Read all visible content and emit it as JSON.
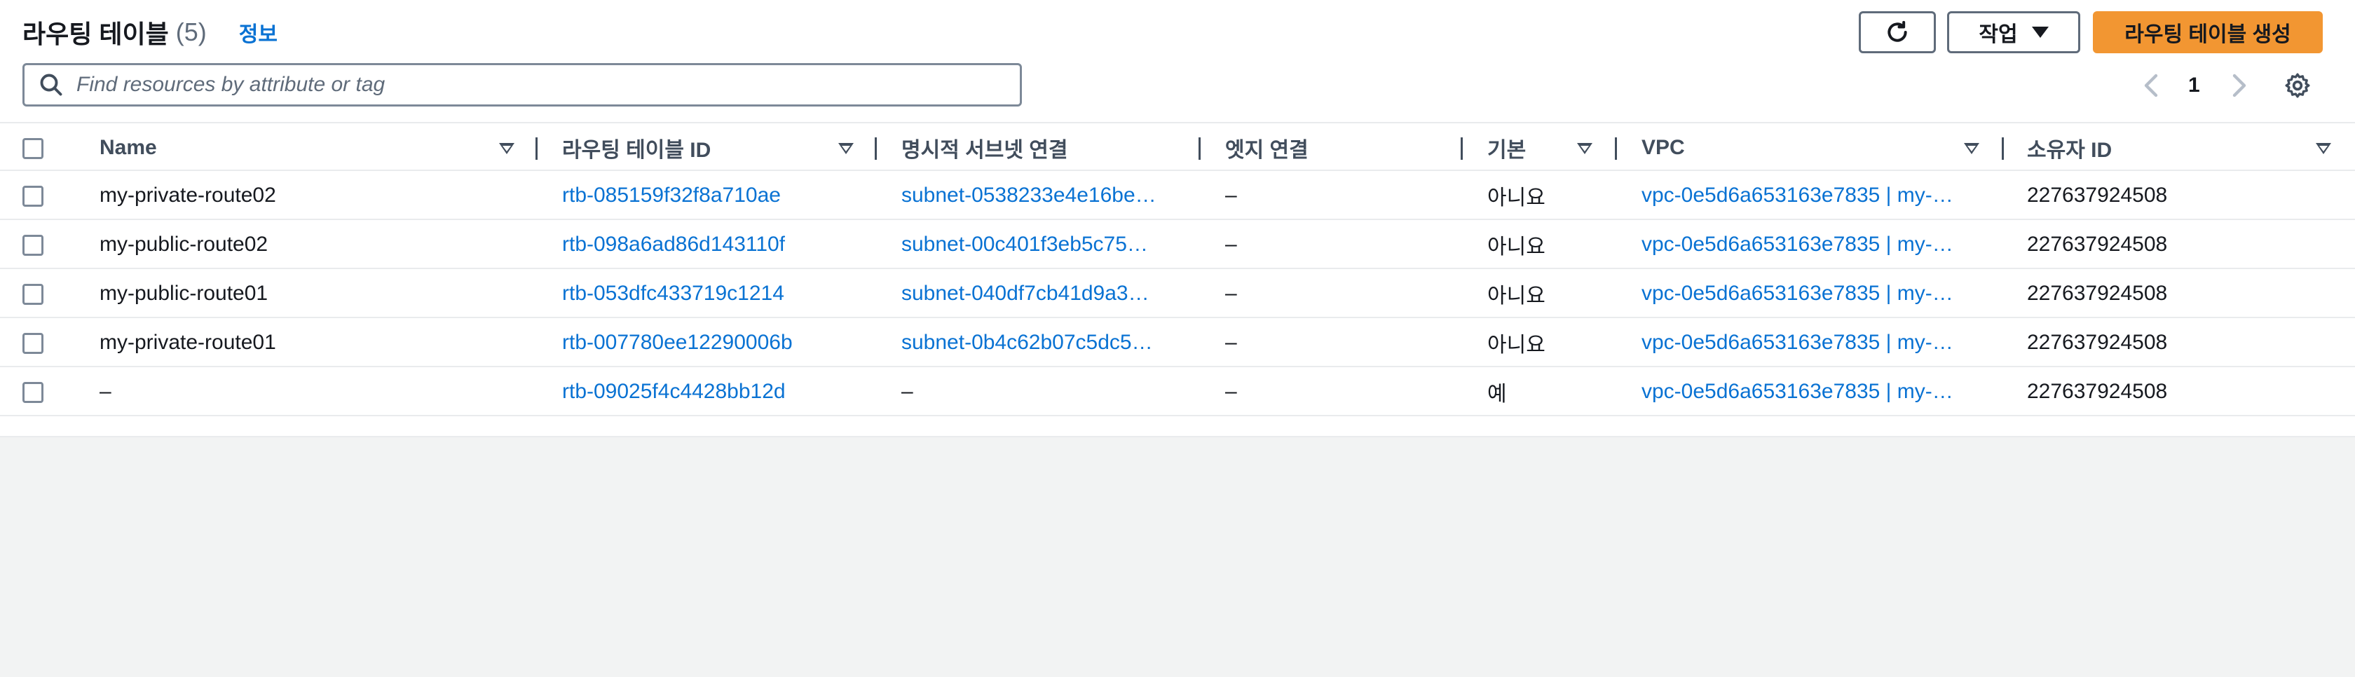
{
  "header": {
    "title": "라우팅 테이블",
    "count": "(5)",
    "info_link": "정보"
  },
  "toolbar": {
    "refresh_icon": "refresh-icon",
    "actions_label": "작업",
    "create_label": "라우팅 테이블 생성"
  },
  "search": {
    "placeholder": "Find resources by attribute or tag"
  },
  "pagination": {
    "current_page": "1"
  },
  "table": {
    "columns": {
      "name": "Name",
      "route_table_id": "라우팅 테이블 ID",
      "explicit_subnet": "명시적 서브넷 연결",
      "edge": "엣지 연결",
      "main": "기본",
      "vpc": "VPC",
      "owner": "소유자 ID"
    },
    "rows": [
      {
        "name": "my-private-route02",
        "rtb": "rtb-085159f32f8a710ae",
        "subnet": "subnet-0538233e4e16be…",
        "edge": "–",
        "main": "아니요",
        "vpc": "vpc-0e5d6a653163e7835 | my-…",
        "owner": "227637924508"
      },
      {
        "name": "my-public-route02",
        "rtb": "rtb-098a6ad86d143110f",
        "subnet": "subnet-00c401f3eb5c75…",
        "edge": "–",
        "main": "아니요",
        "vpc": "vpc-0e5d6a653163e7835 | my-…",
        "owner": "227637924508"
      },
      {
        "name": "my-public-route01",
        "rtb": "rtb-053dfc433719c1214",
        "subnet": "subnet-040df7cb41d9a3…",
        "edge": "–",
        "main": "아니요",
        "vpc": "vpc-0e5d6a653163e7835 | my-…",
        "owner": "227637924508"
      },
      {
        "name": "my-private-route01",
        "rtb": "rtb-007780ee12290006b",
        "subnet": "subnet-0b4c62b07c5dc5…",
        "edge": "–",
        "main": "아니요",
        "vpc": "vpc-0e5d6a653163e7835 | my-…",
        "owner": "227637924508"
      },
      {
        "name": "–",
        "rtb": "rtb-09025f4c4428bb12d",
        "subnet": "–",
        "edge": "–",
        "main": "예",
        "vpc": "vpc-0e5d6a653163e7835 | my-…",
        "owner": "227637924508"
      }
    ]
  },
  "colors": {
    "primary": "#f29632",
    "link": "#0972d3",
    "text": "#16191f",
    "background": "#f2f3f3"
  }
}
